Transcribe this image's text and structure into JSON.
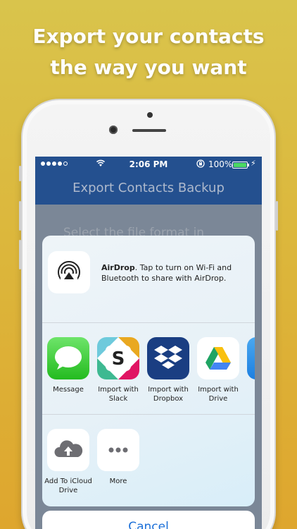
{
  "headline": {
    "line1": "Export your contacts",
    "line2": "the way you want"
  },
  "statusbar": {
    "time": "2:06 PM",
    "battery": "100%",
    "wifi_icon": "wifi-icon",
    "lock_icon": "rotation-lock-icon"
  },
  "app": {
    "title": "Export Contacts Backup",
    "background_text": "Select the file format in"
  },
  "share_sheet": {
    "airdrop": {
      "title": "AirDrop",
      "description": ". Tap to turn on Wi-Fi and Bluetooth to share with AirDrop."
    },
    "apps": [
      {
        "label": "Message",
        "icon": "messages-icon"
      },
      {
        "label": "Import with Slack",
        "icon": "slack-icon"
      },
      {
        "label": "Import with Dropbox",
        "icon": "dropbox-icon"
      },
      {
        "label": "Import with Drive",
        "icon": "google-drive-icon"
      }
    ],
    "actions": [
      {
        "label": "Add To iCloud Drive",
        "icon": "icloud-upload-icon"
      },
      {
        "label": "More",
        "icon": "more-icon"
      }
    ],
    "cancel_label": "Cancel"
  },
  "colors": {
    "background_top": "#d9c44c",
    "background_bottom": "#dea62e",
    "nav_blue": "#24508f",
    "cancel_blue": "#1b6fd8",
    "battery_green": "#4cd964"
  }
}
